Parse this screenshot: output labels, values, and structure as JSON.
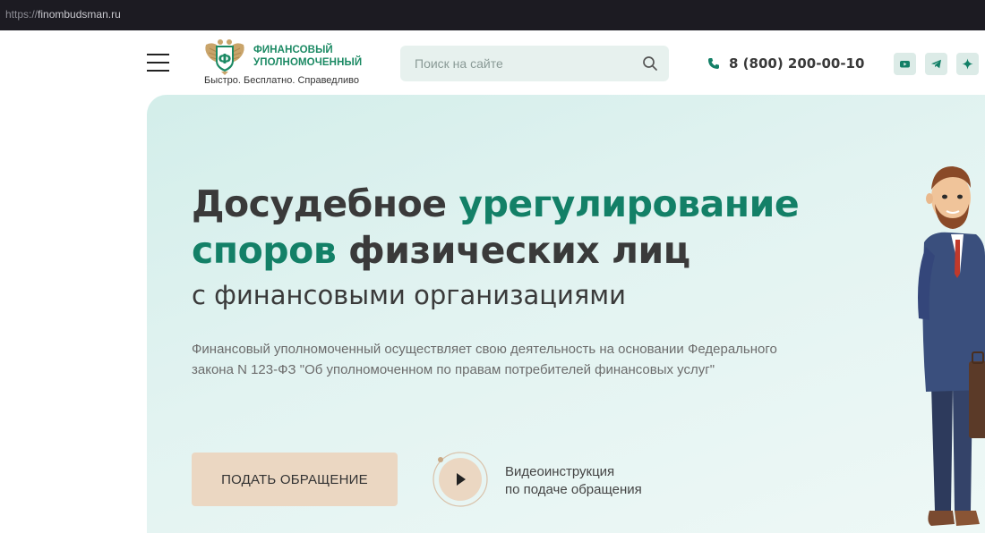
{
  "browser": {
    "url_protocol": "https://",
    "url_host": "finombudsman.ru"
  },
  "header": {
    "menu_icon": "hamburger-menu-icon",
    "logo": {
      "emblem_letter": "Ф",
      "title_line1": "ФИНАНСОВЫЙ",
      "title_line2": "УПОЛНОМОЧЕННЫЙ",
      "tagline": "Быстро. Бесплатно. Справедливо"
    },
    "search": {
      "placeholder": "Поиск на сайте",
      "value": ""
    },
    "phone": "8 (800) 200-00-10",
    "social": [
      "youtube-icon",
      "telegram-icon",
      "sparkle-icon"
    ]
  },
  "hero": {
    "title_part1": "Досудебное ",
    "title_part2": "урегулирование",
    "title_part3": "споров",
    "title_part4": " физических лиц",
    "subtitle": "с финансовыми организациями",
    "description": "Финансовый уполномоченный осуществляет свою деятельность на основании Федерального закона N 123-ФЗ \"Об уполномоченном по правам потребителей финансовых услуг\"",
    "cta_label": "ПОДАТЬ ОБРАЩЕНИЕ",
    "video_line1": "Видеоинструкция",
    "video_line2": "по подаче обращения"
  },
  "colors": {
    "accent_green": "#138067",
    "logo_green": "#1c8a64",
    "cta_beige": "#ebd7c2",
    "text_dark": "#3a3a3a",
    "hero_bg": "#d3eeea"
  }
}
